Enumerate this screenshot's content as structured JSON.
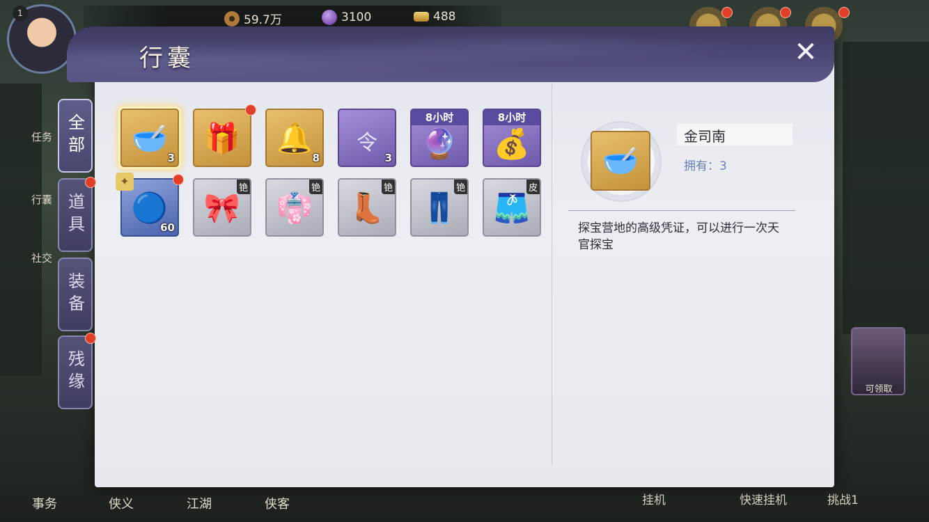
{
  "player": {
    "level": "1"
  },
  "resources": [
    {
      "icon": "copper-coin-icon",
      "value": "59.7万",
      "color": "#b07a3c"
    },
    {
      "icon": "purple-gem-icon",
      "value": "3100",
      "color": "#7a4ab8"
    },
    {
      "icon": "gold-ingot-icon",
      "value": "488",
      "color": "#d8a83a"
    }
  ],
  "left_side": [
    "任务",
    "行囊",
    "社交"
  ],
  "bottom_nav": [
    "事务",
    "侠义",
    "江湖",
    "侠客"
  ],
  "bottom_right": [
    "挂机",
    "快速挂机",
    "挑战1"
  ],
  "bonus": {
    "label": "可领取"
  },
  "modal": {
    "title": "行囊",
    "tabs": [
      "全部",
      "道具",
      "装备",
      "残缘"
    ]
  },
  "items": [
    {
      "name": "jinsinan-item",
      "qty": "3",
      "glyph": "🥣",
      "tier": "gold"
    },
    {
      "name": "treasure-chest-item",
      "qty": "",
      "glyph": "🎁",
      "tier": "gold"
    },
    {
      "name": "bell-item",
      "qty": "8",
      "glyph": "🔔",
      "tier": "gold"
    },
    {
      "name": "token-item",
      "qty": "3",
      "glyph": "令",
      "tier": "purple"
    },
    {
      "name": "orb-pack-item",
      "qty": "",
      "glyph": "🔮",
      "tier": "purple",
      "time": "8小时"
    },
    {
      "name": "coin-pack-item",
      "qty": "",
      "glyph": "💰",
      "tier": "purple",
      "time": "8小时"
    },
    {
      "name": "blue-orb-item",
      "qty": "60",
      "glyph": "🔵",
      "tier": "blue"
    },
    {
      "name": "headband-item",
      "qty": "",
      "glyph": "🎀",
      "tier": "gray",
      "tag": "铯"
    },
    {
      "name": "robe-item",
      "qty": "",
      "glyph": "👘",
      "tier": "gray",
      "tag": "铯"
    },
    {
      "name": "boots-item",
      "qty": "",
      "glyph": "👢",
      "tier": "gray",
      "tag": "铯"
    },
    {
      "name": "pants-item",
      "qty": "",
      "glyph": "👖",
      "tier": "gray",
      "tag": "铯"
    },
    {
      "name": "black-pants-item",
      "qty": "",
      "glyph": "🩳",
      "tier": "gray",
      "tag": "皮"
    }
  ],
  "detail": {
    "name": "金司南",
    "owned": "拥有：3",
    "description": "探宝营地的高级凭证，可以进行一次天官探宝"
  }
}
